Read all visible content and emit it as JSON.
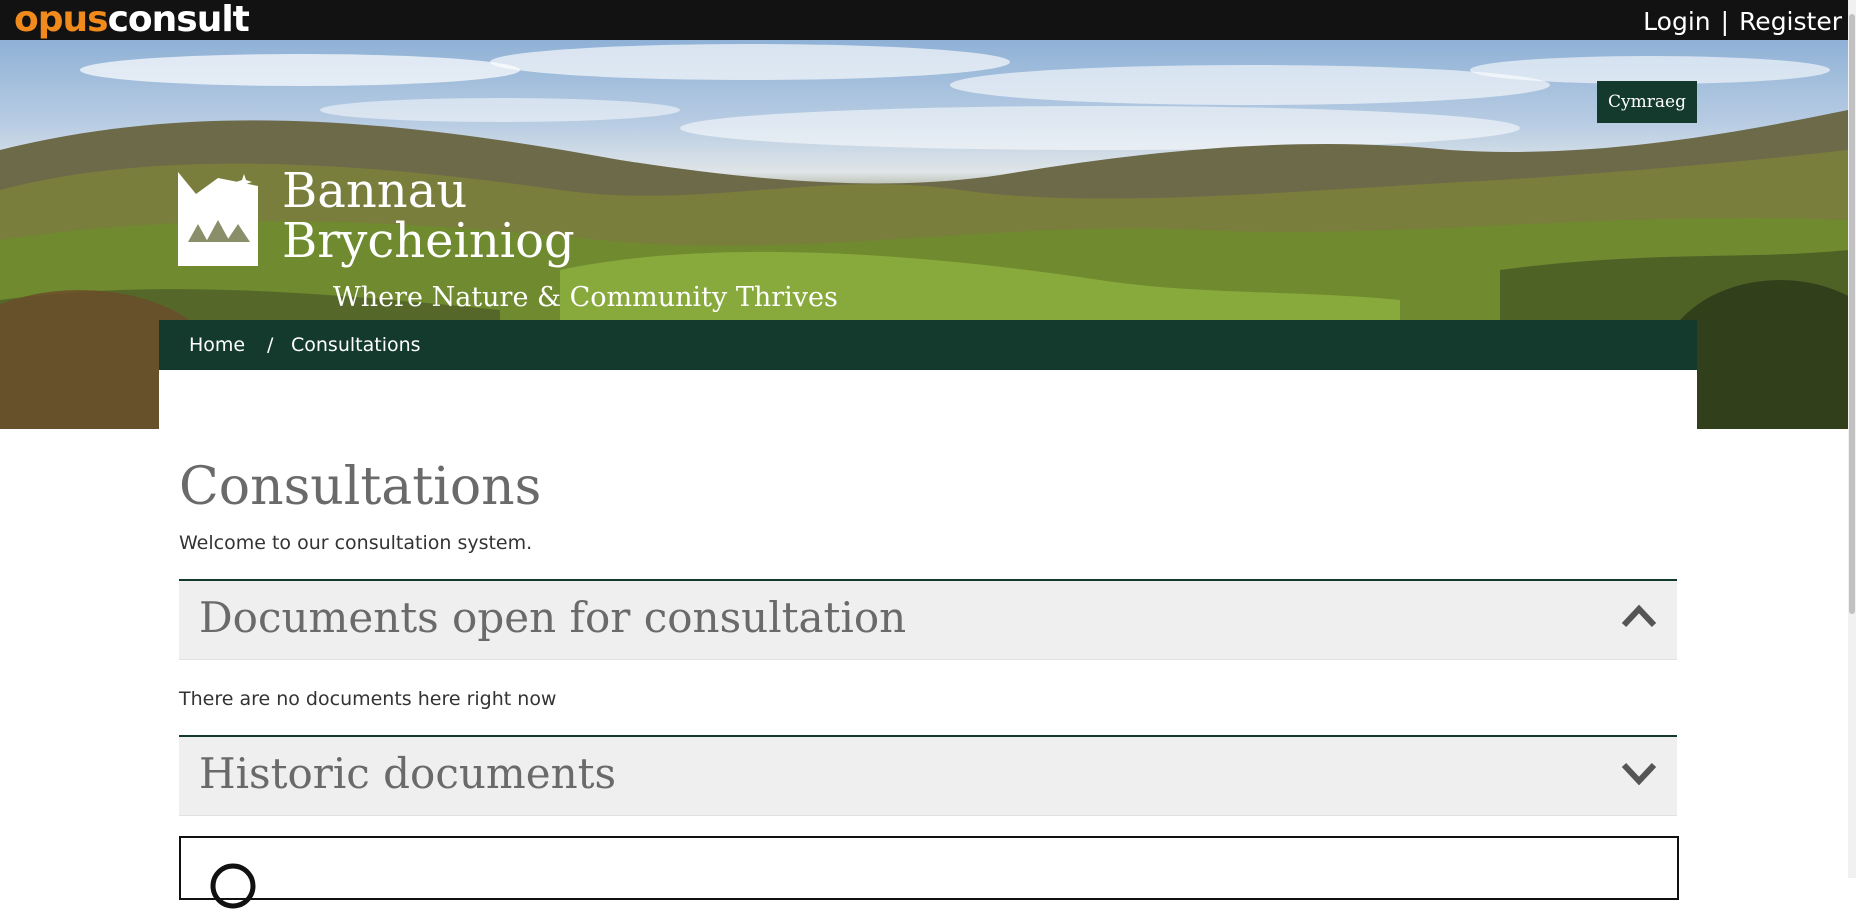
{
  "topbar": {
    "brand_opus": "opus",
    "brand_consult": "consult",
    "login": "Login",
    "separator": "|",
    "register": "Register"
  },
  "hero": {
    "language_toggle": "Cymraeg",
    "logo_line1": "Bannau",
    "logo_line2": "Brycheiniog",
    "tagline": "Where Nature & Community Thrives"
  },
  "breadcrumb": {
    "home": "Home",
    "separator": "/",
    "current": "Consultations"
  },
  "main": {
    "title": "Consultations",
    "intro": "Welcome to our consultation system.",
    "sections": [
      {
        "title": "Documents open for consultation",
        "expanded": true,
        "empty_message": "There are no documents here right now",
        "chevron": "chevron-up-icon"
      },
      {
        "title": "Historic documents",
        "expanded": false,
        "chevron": "chevron-down-icon"
      }
    ]
  },
  "colors": {
    "dark_green": "#143a2e",
    "brand_orange": "#f08a1c",
    "topbar_bg": "#121212",
    "panel_bg": "#efefef",
    "heading_grey": "#6a6a6a"
  }
}
